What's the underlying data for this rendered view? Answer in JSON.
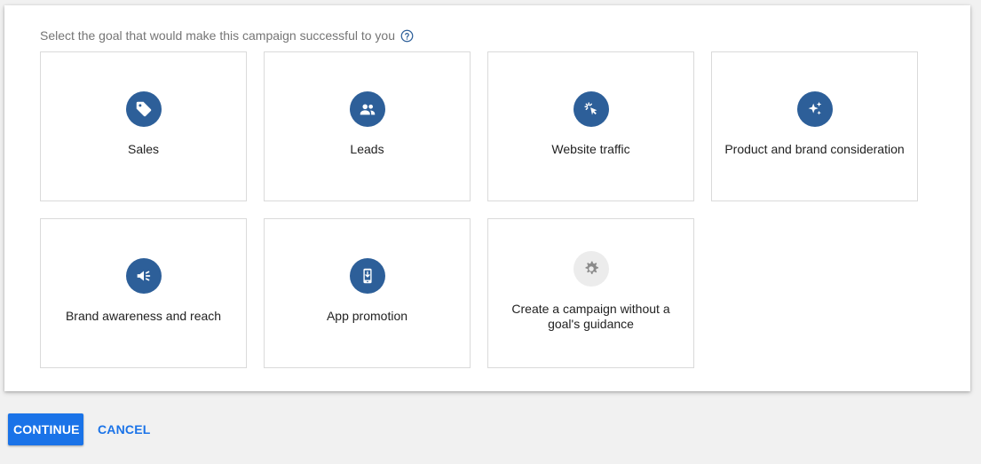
{
  "prompt": {
    "text": "Select the goal that would make this campaign successful to you",
    "help_icon": "help-circle-icon"
  },
  "goals": [
    {
      "label": "Sales",
      "icon": "tag-icon"
    },
    {
      "label": "Leads",
      "icon": "people-icon"
    },
    {
      "label": "Website traffic",
      "icon": "cursor-click-icon"
    },
    {
      "label": "Product and brand consideration",
      "icon": "sparkle-icon"
    },
    {
      "label": "Brand awareness and reach",
      "icon": "megaphone-icon"
    },
    {
      "label": "App promotion",
      "icon": "phone-download-icon"
    },
    {
      "label": "Create a campaign without a goal's guidance",
      "icon": "gear-icon"
    }
  ],
  "actions": {
    "continue_label": "CONTINUE",
    "cancel_label": "CANCEL"
  },
  "colors": {
    "icon_circle": "#2d5f99",
    "primary": "#1a73e8",
    "muted_circle": "#ececec"
  }
}
